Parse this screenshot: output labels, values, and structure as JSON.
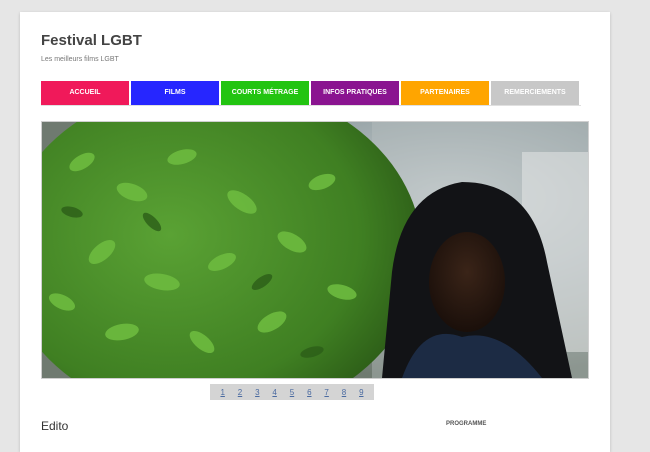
{
  "site": {
    "title": "Festival LGBT",
    "description": "Les meilleurs films LGBT"
  },
  "nav": [
    {
      "label": "Accueil",
      "color": "#f0195a"
    },
    {
      "label": "Films",
      "color": "#2626ff"
    },
    {
      "label": "Courts métrage",
      "color": "#22c411"
    },
    {
      "label": "Infos pratiques",
      "color": "#8a1490"
    },
    {
      "label": "Partenaires",
      "color": "#ffa500"
    },
    {
      "label": "Remerciements",
      "color": "#c8c8c8"
    }
  ],
  "slider": {
    "pages": [
      "1",
      "2",
      "3",
      "4",
      "5",
      "6",
      "7",
      "8",
      "9"
    ]
  },
  "content": {
    "entry_title": "Edito"
  },
  "sidebar": {
    "widget_title": "Programme"
  }
}
